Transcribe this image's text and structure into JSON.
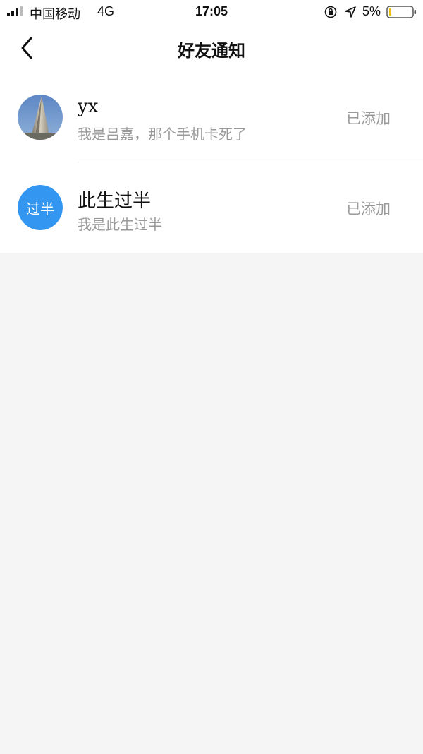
{
  "status_bar": {
    "carrier": "中国移动",
    "network": "4G",
    "time": "17:05",
    "battery_percent": "5%",
    "icons": [
      "signal-icon",
      "lock-rotation-icon",
      "location-icon",
      "battery-icon"
    ]
  },
  "nav": {
    "title": "好友通知",
    "back_icon": "chevron-left-icon"
  },
  "notifications": [
    {
      "name": "yx",
      "message": "我是吕嘉，那个手机卡死了",
      "status": "已添加",
      "avatar": "photo"
    },
    {
      "name": "此生过半",
      "message": "我是此生过半",
      "status": "已添加",
      "avatar_text": "过半",
      "avatar_color": "#3396f1"
    }
  ],
  "colors": {
    "page_background": "#f5f5f5",
    "card_background": "#ffffff",
    "secondary_text": "#9a9a9a",
    "avatar_blue": "#3396f1"
  }
}
